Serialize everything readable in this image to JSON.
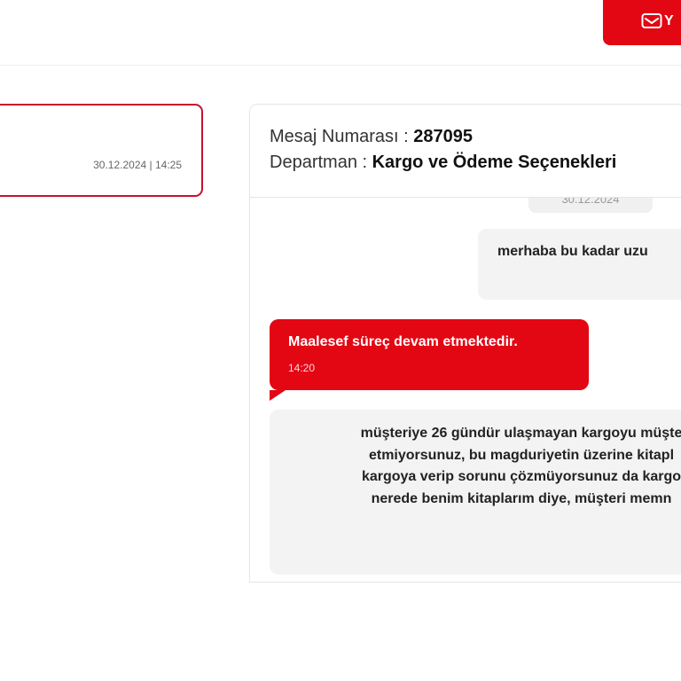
{
  "header": {
    "new_message_label": "Y"
  },
  "conversation_list": [
    {
      "date": "30.12.2024 | 14:25"
    }
  ],
  "detail": {
    "message_number_label": "Mesaj Numarası : ",
    "message_number": "287095",
    "department_label": "Departman : ",
    "department": "Kargo ve Ödeme Seçenekleri",
    "date_pill": "30.12.2024",
    "messages": [
      {
        "text": "merhaba bu kadar uzu"
      },
      {
        "text": "Maalesef süreç devam etmektedir.",
        "time": "14:20"
      },
      {
        "lines": [
          "müşteriye 26 gündür ulaşmayan kargoyu müşte",
          "etmiyorsunuz, bu magduriyetin üzerine kitapl",
          "kargoya verip sorunu çözmüyorsunuz da kargo",
          "nerede benim kitaplarım diye, müşteri memn"
        ]
      }
    ]
  },
  "colors": {
    "accent": "#e30613",
    "card_border": "#c8102e",
    "bubble_gray": "#f3f3f3"
  }
}
